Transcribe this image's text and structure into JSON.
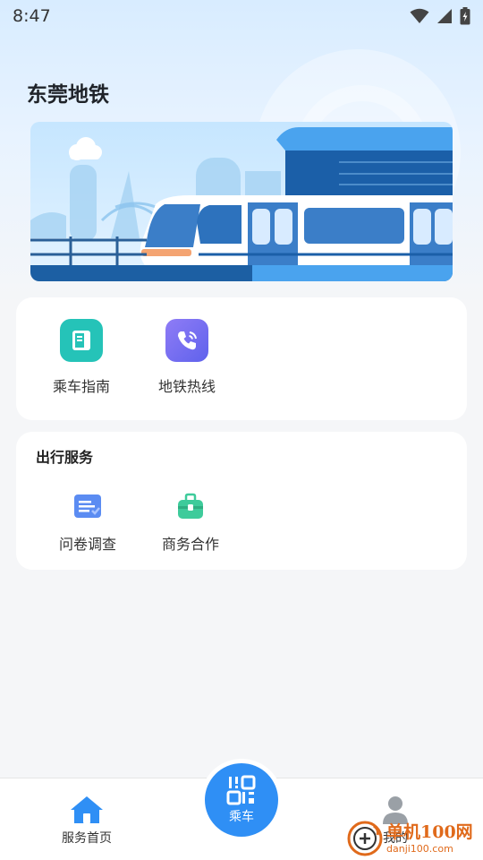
{
  "status_bar": {
    "time": "8:47"
  },
  "header": {
    "title": "东莞地铁"
  },
  "quick_entries": [
    {
      "label": "乘车指南",
      "icon": "book-icon",
      "color": "#25c3b8"
    },
    {
      "label": "地铁热线",
      "icon": "phone-icon",
      "color": "#7a6ff2"
    }
  ],
  "travel_services": {
    "title": "出行服务",
    "items": [
      {
        "label": "问卷调查",
        "icon": "survey-icon",
        "color": "#5b8cf2"
      },
      {
        "label": "商务合作",
        "icon": "briefcase-icon",
        "color": "#3ecb9b"
      }
    ]
  },
  "tabbar": {
    "home_label": "服务首页",
    "ride_label": "乘车",
    "profile_label": "我的"
  },
  "watermark": {
    "main": "单机100网",
    "sub": "danji100.com"
  },
  "colors": {
    "accent": "#2f8ff5",
    "background": "#f5f6f8"
  }
}
